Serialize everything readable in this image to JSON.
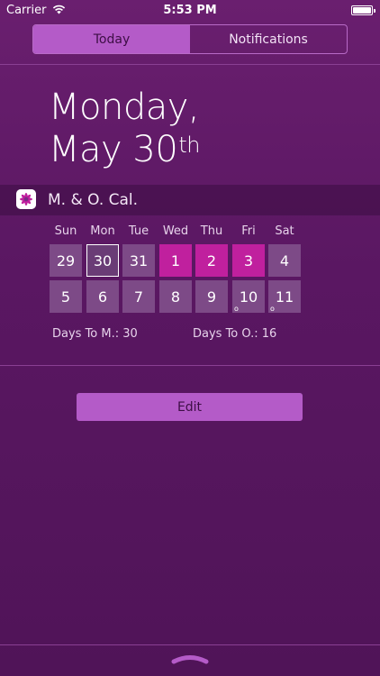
{
  "status_bar": {
    "carrier": "Carrier",
    "time": "5:53 PM"
  },
  "tabs": [
    {
      "label": "Today",
      "active": true
    },
    {
      "label": "Notifications",
      "active": false
    }
  ],
  "date": {
    "line1": "Monday,",
    "month_day": "May 30",
    "suffix": "th"
  },
  "widget": {
    "title": "M. & O. Cal.",
    "weekdays": [
      "Sun",
      "Mon",
      "Tue",
      "Wed",
      "Thu",
      "Fri",
      "Sat"
    ],
    "weeks": [
      [
        {
          "day": "29",
          "state": "normal",
          "dot": ""
        },
        {
          "day": "30",
          "state": "today",
          "dot": ""
        },
        {
          "day": "31",
          "state": "normal",
          "dot": ""
        },
        {
          "day": "1",
          "state": "highlight",
          "dot": ""
        },
        {
          "day": "2",
          "state": "highlight",
          "dot": ""
        },
        {
          "day": "3",
          "state": "highlight",
          "dot": ""
        },
        {
          "day": "4",
          "state": "normal",
          "dot": ""
        }
      ],
      [
        {
          "day": "5",
          "state": "normal",
          "dot": ""
        },
        {
          "day": "6",
          "state": "normal",
          "dot": ""
        },
        {
          "day": "7",
          "state": "normal",
          "dot": ""
        },
        {
          "day": "8",
          "state": "normal",
          "dot": ""
        },
        {
          "day": "9",
          "state": "normal",
          "dot": ""
        },
        {
          "day": "10",
          "state": "normal",
          "dot": "o"
        },
        {
          "day": "11",
          "state": "normal",
          "dot": "o"
        }
      ]
    ],
    "days_to_m": "Days To M.: 30",
    "days_to_o": "Days To O.: 16"
  },
  "edit_label": "Edit",
  "colors": {
    "accent": "#b45bc8",
    "highlight": "#c0209e",
    "background": "#5a1762"
  }
}
